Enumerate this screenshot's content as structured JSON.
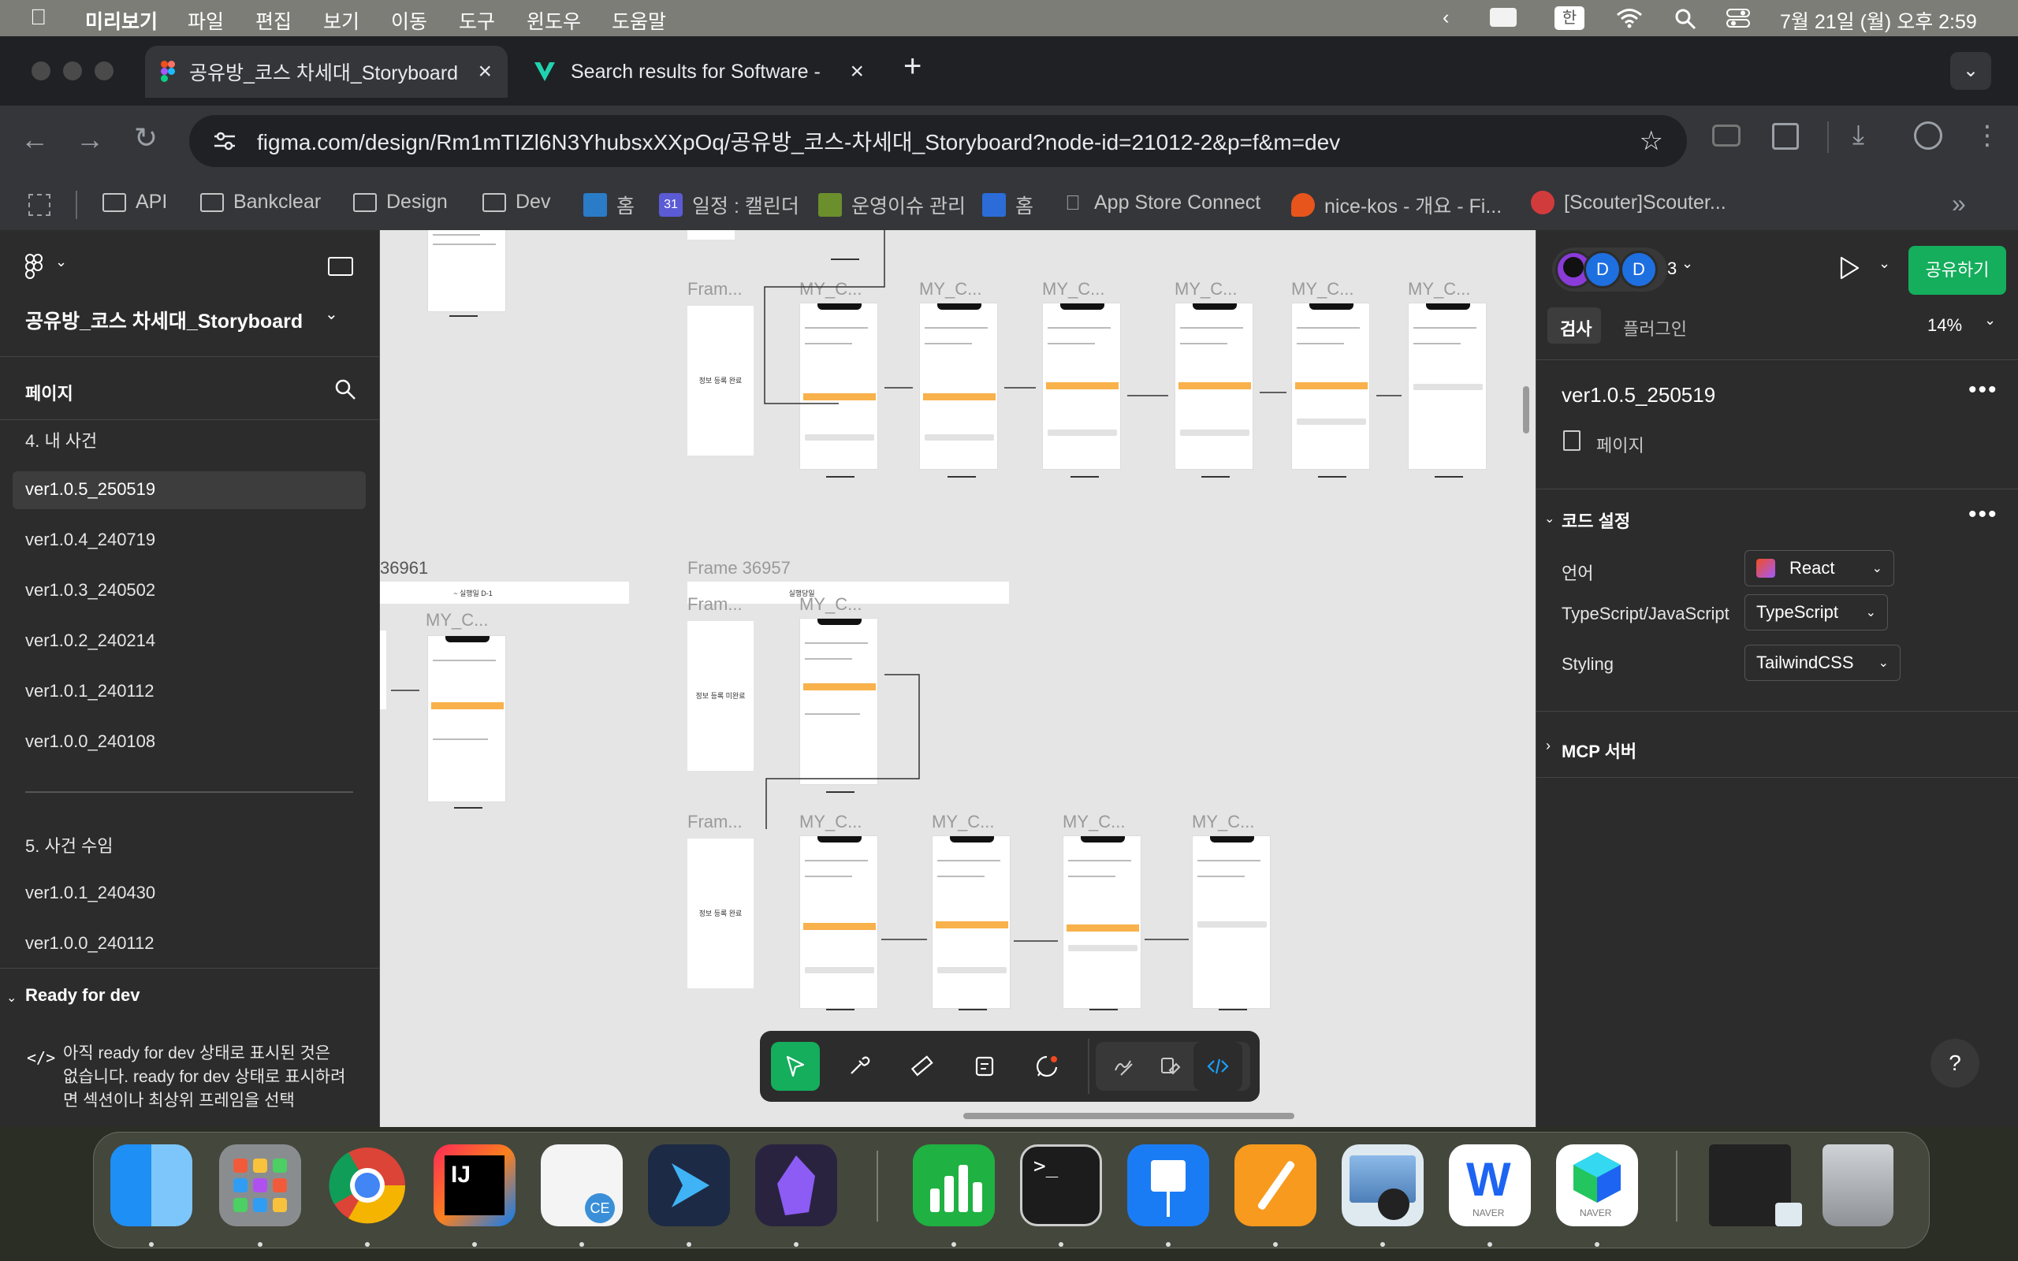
{
  "menubar": {
    "app": "미리보기",
    "items": [
      "파일",
      "편집",
      "보기",
      "이동",
      "도구",
      "윈도우",
      "도움말"
    ],
    "input_source": "한",
    "datetime": "7월 21일 (월) 오후 2:59"
  },
  "browser": {
    "tabs": [
      {
        "title": "공유방_코스 차세대_Storyboard"
      },
      {
        "title": "Search results for Software -"
      }
    ],
    "url": "figma.com/design/Rm1mTIZl6N3YhubsxXXpOq/공유방_코스-차세대_Storyboard?node-id=21012-2&p=f&m=dev",
    "bookmarks": [
      "API",
      "Bankclear",
      "Design",
      "Dev",
      "홈",
      "일정 : 캘린더",
      "운영이슈 관리",
      "홈",
      "App Store Connect",
      "nice-kos - 개요 - Fi...",
      "[Scouter]Scouter..."
    ]
  },
  "figma": {
    "file_name": "공유방_코스 차세대_Storyboard",
    "pages_label": "페이지",
    "pages": [
      {
        "label": "4. 내 사건",
        "selected": false
      },
      {
        "label": "ver1.0.5_250519",
        "selected": true
      },
      {
        "label": "ver1.0.4_240719",
        "selected": false
      },
      {
        "label": "ver1.0.3_240502",
        "selected": false
      },
      {
        "label": "ver1.0.2_240214",
        "selected": false
      },
      {
        "label": "ver1.0.1_240112",
        "selected": false
      },
      {
        "label": "ver1.0.0_240108",
        "selected": false
      },
      {
        "label": "5. 사건 수임",
        "selected": false
      },
      {
        "label": "ver1.0.1_240430",
        "selected": false
      },
      {
        "label": "ver1.0.0_240112",
        "selected": false
      }
    ],
    "ready_for_dev": {
      "title": "Ready for dev",
      "text": "아직 ready for dev 상태로 표시된 것은 없습니다. ready for dev 상태로 표시하려면 섹션이나 최상위 프레임을 선택"
    },
    "canvas": {
      "frame_label_short": "Fram...",
      "screen_label": "MY_C...",
      "frame_36957": "Frame 36957",
      "frame_36961": "36961",
      "section_d1": "~ 실행일 D-1",
      "section_day": "실행당일",
      "info_done": "정보 등록 완료",
      "info_not_done": "정보 등록 미완료"
    },
    "right": {
      "avatars": [
        "D",
        "D"
      ],
      "collab_count": "3",
      "share": "공유하기",
      "tab_inspect": "검사",
      "tab_plugin": "플러그인",
      "zoom": "14%",
      "selection_name": "ver1.0.5_250519",
      "selection_type": "페이지",
      "code_settings": "코드 설정",
      "language_label": "언어",
      "language_value": "React",
      "ts_label": "TypeScript/JavaScript",
      "ts_value": "TypeScript",
      "styling_label": "Styling",
      "styling_value": "TailwindCSS",
      "mcp": "MCP 서버",
      "help": "?"
    }
  },
  "dock": [
    "Finder",
    "Launchpad",
    "Chrome",
    "IntelliJ IDEA",
    "CE",
    "Xcode-like",
    "Obsidian",
    "Numbers",
    "Terminal",
    "Keynote",
    "Pages",
    "Preview",
    "Naver Whale",
    "Naver",
    "Trash"
  ]
}
